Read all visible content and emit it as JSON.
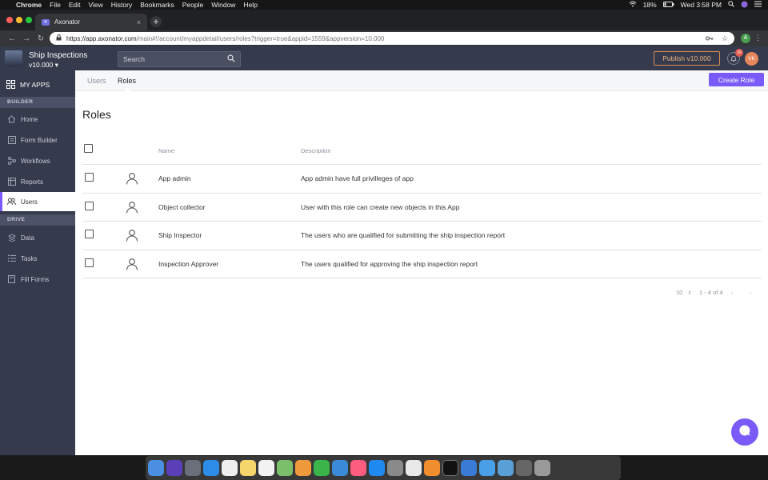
{
  "menubar": {
    "app": "Chrome",
    "menus": [
      "File",
      "Edit",
      "View",
      "History",
      "Bookmarks",
      "People",
      "Window",
      "Help"
    ],
    "battery": "18%",
    "clock": "Wed 3:58 PM"
  },
  "browser": {
    "tab_title": "Axonator",
    "url_host": "https://app.axonator.com",
    "url_path": "/main#!/account/myappdetail/users/roles?trigger=true&appid=1559&appversion=10.000",
    "profile_initial": "A"
  },
  "header": {
    "app_name": "Ship Inspections",
    "version": "v10.000",
    "search_placeholder": "Search",
    "publish_label": "Publish v10.000",
    "notification_count": "16",
    "user_initials": "VK"
  },
  "sidebar": {
    "my_apps": "MY APPS",
    "builder_section": "BUILDER",
    "builder_items": [
      {
        "label": "Home",
        "icon": "home-icon"
      },
      {
        "label": "Form Builder",
        "icon": "form-icon"
      },
      {
        "label": "Workflows",
        "icon": "workflow-icon"
      },
      {
        "label": "Reports",
        "icon": "reports-icon"
      },
      {
        "label": "Users",
        "icon": "users-icon"
      }
    ],
    "drive_section": "DRIVE",
    "drive_items": [
      {
        "label": "Data",
        "icon": "data-icon"
      },
      {
        "label": "Tasks",
        "icon": "tasks-icon"
      },
      {
        "label": "Fill Forms",
        "icon": "fill-forms-icon"
      }
    ]
  },
  "subnav": {
    "tabs": [
      "Users",
      "Roles"
    ],
    "active_tab": "Roles",
    "create_label": "Create Role"
  },
  "page": {
    "title": "Roles"
  },
  "table": {
    "columns": [
      "Name",
      "Description"
    ],
    "rows": [
      {
        "name": "App admin",
        "description": "App admin have full privilleges of app"
      },
      {
        "name": "Object collector",
        "description": "User with this role can create new objects in this App"
      },
      {
        "name": "Ship Inspector",
        "description": "The users who are qualified for submitting the ship inspection report"
      },
      {
        "name": "Inspection Approver",
        "description": "The users qualified for approving the ship inspection report"
      }
    ]
  },
  "pagination": {
    "page_size": "10",
    "range": "1 - 4 of 4"
  },
  "colors": {
    "accent": "#7a5af8",
    "sidebar_bg": "#353a4d",
    "publish": "#d98f54"
  }
}
